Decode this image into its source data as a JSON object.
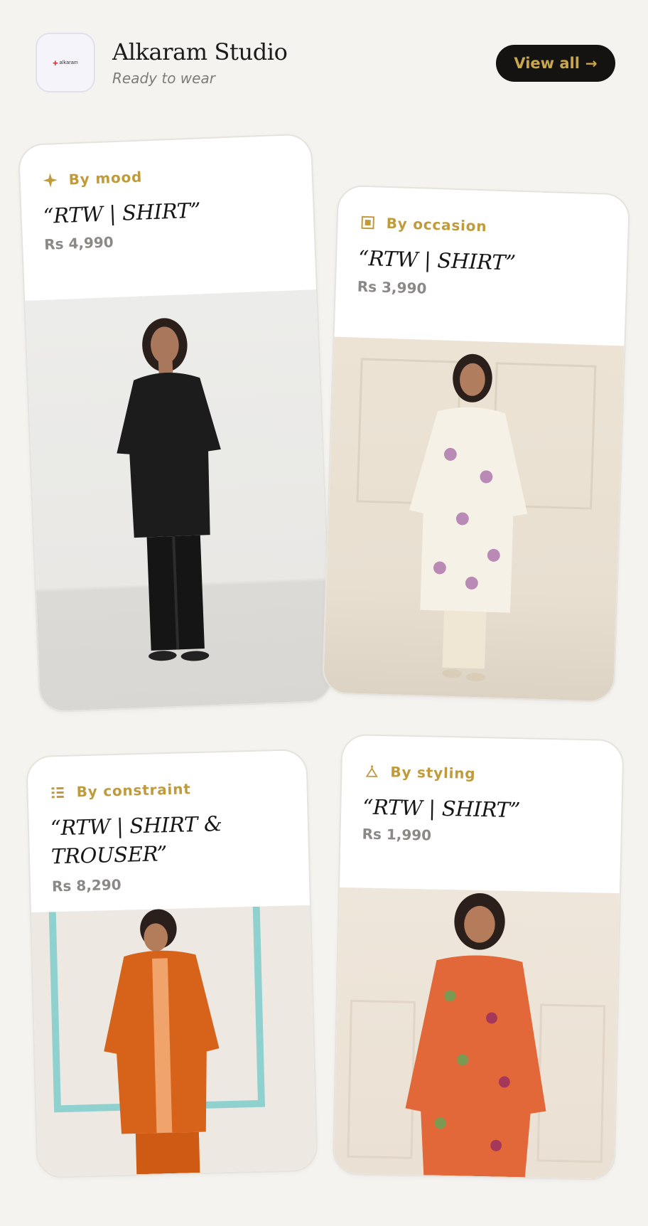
{
  "header": {
    "logo_text": "alkaram",
    "title": "Alkaram Studio",
    "subtitle": "Ready to wear",
    "view_all_label": "View all",
    "view_all_icon": "arrow-right-icon"
  },
  "accent_color": "#c09b3c",
  "button_bg_color": "#141311",
  "cards": [
    {
      "tag": "By mood",
      "tag_icon": "sparkle-icon",
      "name": "“RTW | SHIRT”",
      "price": "Rs 4,990",
      "image": "black printed shirt with black trousers"
    },
    {
      "tag": "By occasion",
      "tag_icon": "square-icon",
      "name": "“RTW | SHIRT”",
      "price": "Rs 3,990",
      "image": "cream floral embroidered shirt"
    },
    {
      "tag": "By constraint",
      "tag_icon": "list-icon",
      "name": "“RTW | SHIRT & TROUSER”",
      "price": "Rs 8,290",
      "image": "orange embroidered shirt and trousers"
    },
    {
      "tag": "By styling",
      "tag_icon": "hanger-icon",
      "name": "“RTW | SHIRT”",
      "price": "Rs 1,990",
      "image": "orange printed long shirt"
    }
  ]
}
